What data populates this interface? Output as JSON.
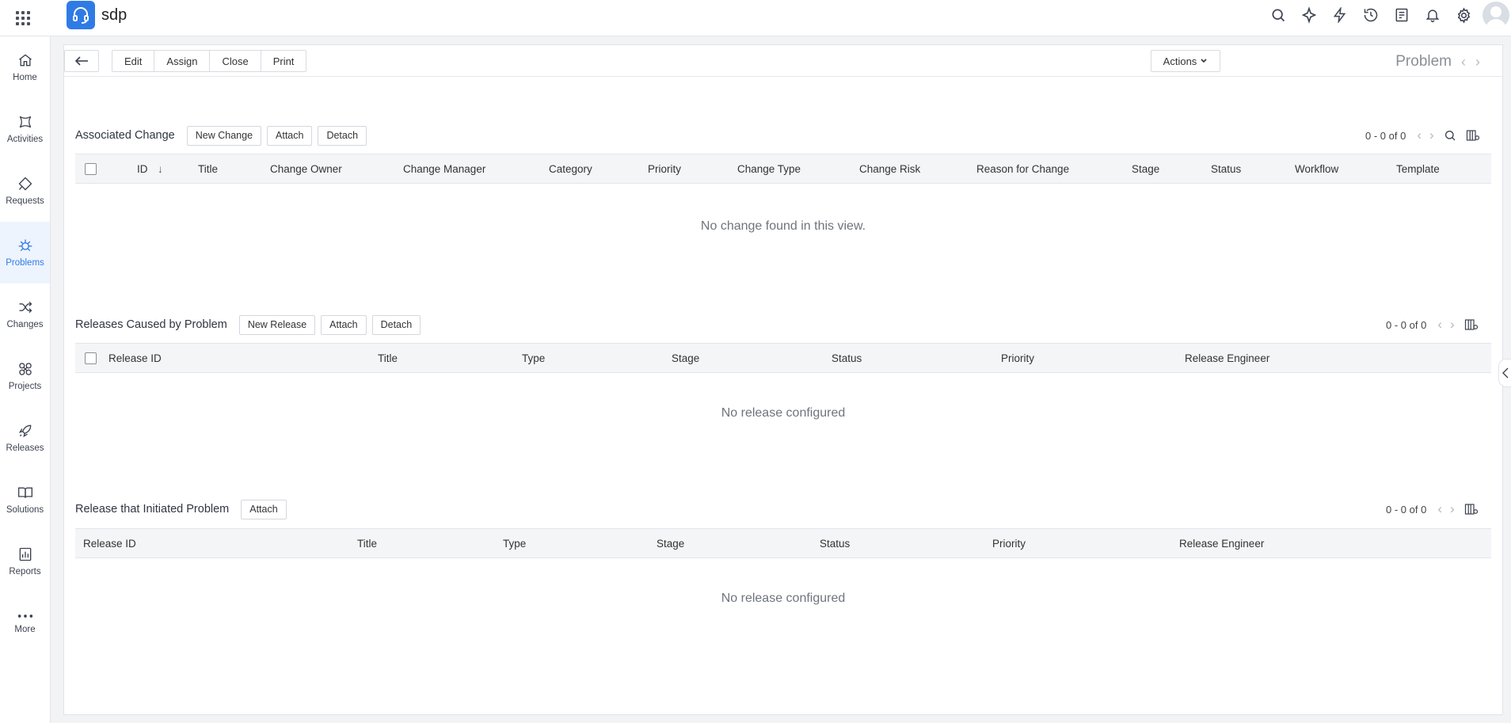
{
  "app": {
    "name": "sdp",
    "accent": "#2f7be6"
  },
  "header_icons": [
    "search-icon",
    "sparkle-icon",
    "lightning-icon",
    "history-icon",
    "notes-icon",
    "bell-icon",
    "gear-icon",
    "avatar"
  ],
  "nav": [
    {
      "key": "home",
      "label": "Home",
      "icon": "home-icon"
    },
    {
      "key": "activities",
      "label": "Activities",
      "icon": "activities-icon"
    },
    {
      "key": "requests",
      "label": "Requests",
      "icon": "requests-icon"
    },
    {
      "key": "problems",
      "label": "Problems",
      "icon": "bug-icon",
      "active": true
    },
    {
      "key": "changes",
      "label": "Changes",
      "icon": "shuffle-icon"
    },
    {
      "key": "projects",
      "label": "Projects",
      "icon": "projects-icon"
    },
    {
      "key": "releases",
      "label": "Releases",
      "icon": "rocket-icon"
    },
    {
      "key": "solutions",
      "label": "Solutions",
      "icon": "book-icon"
    },
    {
      "key": "reports",
      "label": "Reports",
      "icon": "report-icon"
    },
    {
      "key": "more",
      "label": "More",
      "icon": "more-icon"
    }
  ],
  "toolbar": {
    "edit": "Edit",
    "assign": "Assign",
    "close": "Close",
    "print": "Print",
    "actions": "Actions",
    "title": "Problem"
  },
  "associated_change": {
    "title": "Associated Change",
    "new_btn": "New Change",
    "attach_btn": "Attach",
    "detach_btn": "Detach",
    "pager": "0 - 0 of 0",
    "columns": [
      "ID",
      "Title",
      "Change Owner",
      "Change Manager",
      "Category",
      "Priority",
      "Change Type",
      "Change Risk",
      "Reason for Change",
      "Stage",
      "Status",
      "Workflow",
      "Template"
    ],
    "empty": "No change found in this view."
  },
  "releases_caused": {
    "title": "Releases Caused by Problem",
    "new_btn": "New Release",
    "attach_btn": "Attach",
    "detach_btn": "Detach",
    "pager": "0 - 0 of 0",
    "columns": [
      "Release ID",
      "Title",
      "Type",
      "Stage",
      "Status",
      "Priority",
      "Release Engineer"
    ],
    "empty": "No release configured"
  },
  "release_initiated": {
    "title": "Release that Initiated Problem",
    "attach_btn": "Attach",
    "pager": "0 - 0 of 0",
    "columns": [
      "Release ID",
      "Title",
      "Type",
      "Stage",
      "Status",
      "Priority",
      "Release Engineer"
    ],
    "empty": "No release configured"
  }
}
